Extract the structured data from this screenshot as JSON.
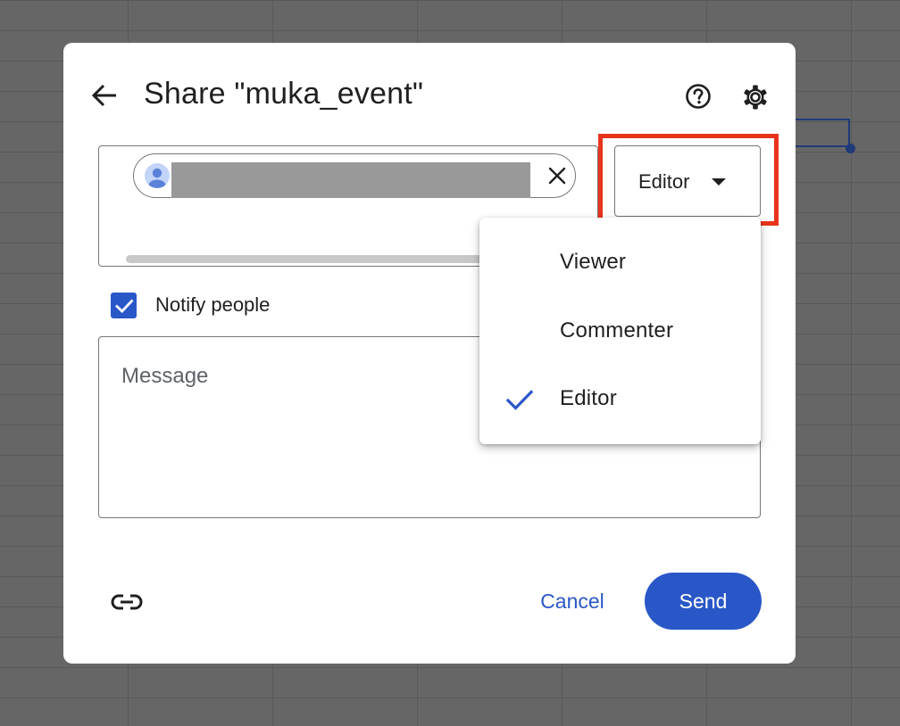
{
  "dialog": {
    "title": "Share \"muka_event\"",
    "back_icon": "arrow-left-icon",
    "help_icon": "help-circle-icon",
    "settings_icon": "gear-icon"
  },
  "people": {
    "chips": [
      {
        "avatar_icon": "person-avatar-icon",
        "name_redacted": true,
        "remove_icon": "close-icon"
      }
    ]
  },
  "role_select": {
    "selected": "Editor",
    "caret_icon": "caret-down-icon",
    "highlight_color": "#e8341c"
  },
  "role_menu": {
    "items": [
      {
        "label": "Viewer",
        "checked": false
      },
      {
        "label": "Commenter",
        "checked": false
      },
      {
        "label": "Editor",
        "checked": true
      }
    ],
    "check_icon": "checkmark-icon"
  },
  "notify": {
    "label": "Notify people",
    "checked": true
  },
  "message": {
    "placeholder": "Message"
  },
  "footer": {
    "link_icon": "link-icon",
    "cancel_label": "Cancel",
    "send_label": "Send"
  },
  "colors": {
    "accent": "#2a57c8",
    "overlay_background": "#666666"
  }
}
